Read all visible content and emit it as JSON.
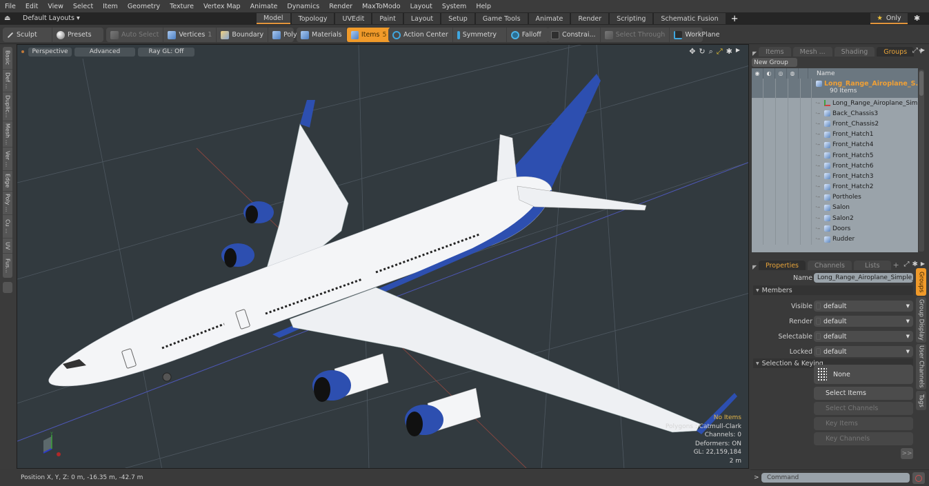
{
  "menubar": [
    "File",
    "Edit",
    "View",
    "Select",
    "Item",
    "Geometry",
    "Texture",
    "Vertex Map",
    "Animate",
    "Dynamics",
    "Render",
    "MaxToModo",
    "Layout",
    "System",
    "Help"
  ],
  "layoutbar": {
    "layouts_label": "Default Layouts ▾",
    "tabs": [
      "Model",
      "Topology",
      "UVEdit",
      "Paint",
      "Layout",
      "Setup",
      "Game Tools",
      "Animate",
      "Render",
      "Scripting",
      "Schematic Fusion"
    ],
    "active_tab": "Model",
    "add_tab_label": "+",
    "only_label": "Only"
  },
  "toolbar": {
    "sculpt": "Sculpt",
    "presets": "Presets",
    "auto_select": "Auto Select",
    "vertices": "Vertices",
    "vertices_count": "1",
    "boundary": "Boundary",
    "polygons": "Polygons",
    "materials": "Materials",
    "items": "Items",
    "items_count": "5",
    "action_center": "Action Center",
    "symmetry": "Symmetry",
    "falloff": "Falloff",
    "constraints": "Constrai...",
    "select_through": "Select Through",
    "workplane": "WorkPlane"
  },
  "left_tabs": [
    "Basic",
    "Def ...",
    "Duplic...",
    "Mesh ...",
    "Ver ...",
    "Edge",
    "Poly ...",
    "Cu ...",
    "UV",
    "Fus..."
  ],
  "viewport": {
    "view_mode": "Perspective",
    "shading": "Advanced",
    "raygl": "Ray GL: Off",
    "info": {
      "selection": "No Items",
      "polygons": "Polygons : Catmull-Clark",
      "channels": "Channels: 0",
      "deformers": "Deformers: ON",
      "gl": "GL: 22,159,184",
      "scale": "2 m"
    },
    "accent_colors": {
      "fuselage": "#f4f5f7",
      "livery": "#2d4fb0"
    }
  },
  "statusbar": {
    "position": "Position X, Y, Z:   0 m, -16.35 m, -42.7 m"
  },
  "groups_panel": {
    "tabs": [
      "Items",
      "Mesh ...",
      "Shading",
      "Groups"
    ],
    "active_tab": "Groups",
    "new_group": "New Group",
    "col_name": "Name",
    "root": {
      "name": "Long_Range_Airoplane_S...",
      "count": "90 Items"
    },
    "items": [
      {
        "name": "Long_Range_Airoplane_Sim ...",
        "type": "locator"
      },
      {
        "name": "Back_Chassis3",
        "type": "mesh"
      },
      {
        "name": "Front_Chassis2",
        "type": "mesh"
      },
      {
        "name": "Front_Hatch1",
        "type": "mesh"
      },
      {
        "name": "Front_Hatch4",
        "type": "mesh"
      },
      {
        "name": "Front_Hatch5",
        "type": "mesh"
      },
      {
        "name": "Front_Hatch6",
        "type": "mesh"
      },
      {
        "name": "Front_Hatch3",
        "type": "mesh"
      },
      {
        "name": "Front_Hatch2",
        "type": "mesh"
      },
      {
        "name": "Portholes",
        "type": "mesh"
      },
      {
        "name": "Salon",
        "type": "mesh"
      },
      {
        "name": "Salon2",
        "type": "mesh"
      },
      {
        "name": "Doors",
        "type": "mesh"
      },
      {
        "name": "Rudder",
        "type": "mesh"
      }
    ]
  },
  "properties_panel": {
    "tabs": [
      "Properties",
      "Channels",
      "Lists",
      "+"
    ],
    "active_tab": "Properties",
    "name_label": "Name",
    "name_value": "Long_Range_Airoplane_Simple_Ir",
    "members_section": "Members",
    "members": [
      {
        "label": "Visible",
        "value": "default"
      },
      {
        "label": "Render",
        "value": "default"
      },
      {
        "label": "Selectable",
        "value": "default"
      },
      {
        "label": "Locked",
        "value": "default"
      }
    ],
    "keying_section": "Selection & Keying",
    "none_label": "None",
    "select_items": "Select Items",
    "select_channels": "Select Channels",
    "key_items": "Key Items",
    "key_channels": "Key Channels",
    "more": ">>",
    "side_tabs": [
      "Groups",
      "Group Display",
      "User Channels",
      "Tags"
    ],
    "active_side_tab": "Groups"
  },
  "command": {
    "prompt": ">",
    "placeholder": "Command"
  }
}
